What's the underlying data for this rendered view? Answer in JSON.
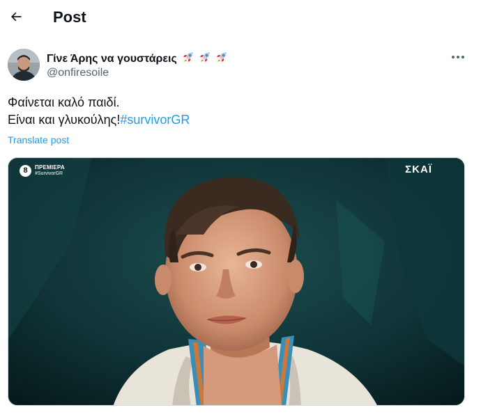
{
  "header": {
    "title": "Post",
    "back_icon": "arrow-left-icon"
  },
  "post": {
    "display_name": "Γίνε Άρης να γουστάρεις",
    "rocket_emoji_count": 3,
    "handle": "@onfiresoile",
    "text_line1": "Φαίνεται καλό παιδί.",
    "text_line2_prefix": "Είναι και γλυκούλης!",
    "hashtag": "#survivorGR",
    "translate_label": "Translate post",
    "more_icon": "more-dots-icon"
  },
  "media": {
    "premiere_badge": "8",
    "premiere_label": "ΠΡΕΜΙΕΡΑ",
    "premiere_hashtag": "#SurvivorGR",
    "channel_logo": "ΣΚΑΪ"
  },
  "colors": {
    "link": "#1d9bf0",
    "secondary_text": "#536471",
    "primary_text": "#0f1419"
  }
}
